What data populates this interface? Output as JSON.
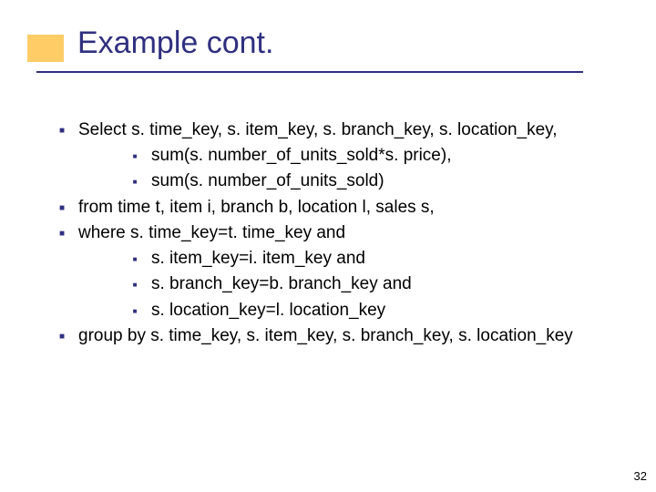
{
  "title": "Example cont.",
  "page_number": "32",
  "body": {
    "items": [
      {
        "level": 1,
        "text": "Select s. time_key, s. item_key, s. branch_key, s. location_key,"
      },
      {
        "level": 2,
        "text": "sum(s. number_of_units_sold*s. price),"
      },
      {
        "level": 2,
        "text": "sum(s. number_of_units_sold)"
      },
      {
        "level": 1,
        "text": "from time t, item i, branch b, location l, sales s,"
      },
      {
        "level": 1,
        "text": "where s. time_key=t. time_key and"
      },
      {
        "level": 2,
        "text": "s. item_key=i. item_key and"
      },
      {
        "level": 2,
        "text": "s. branch_key=b. branch_key and"
      },
      {
        "level": 2,
        "text": "s. location_key=l. location_key"
      },
      {
        "level": 1,
        "text": "group by s. time_key, s. item_key, s. branch_key, s. location_key"
      }
    ]
  }
}
